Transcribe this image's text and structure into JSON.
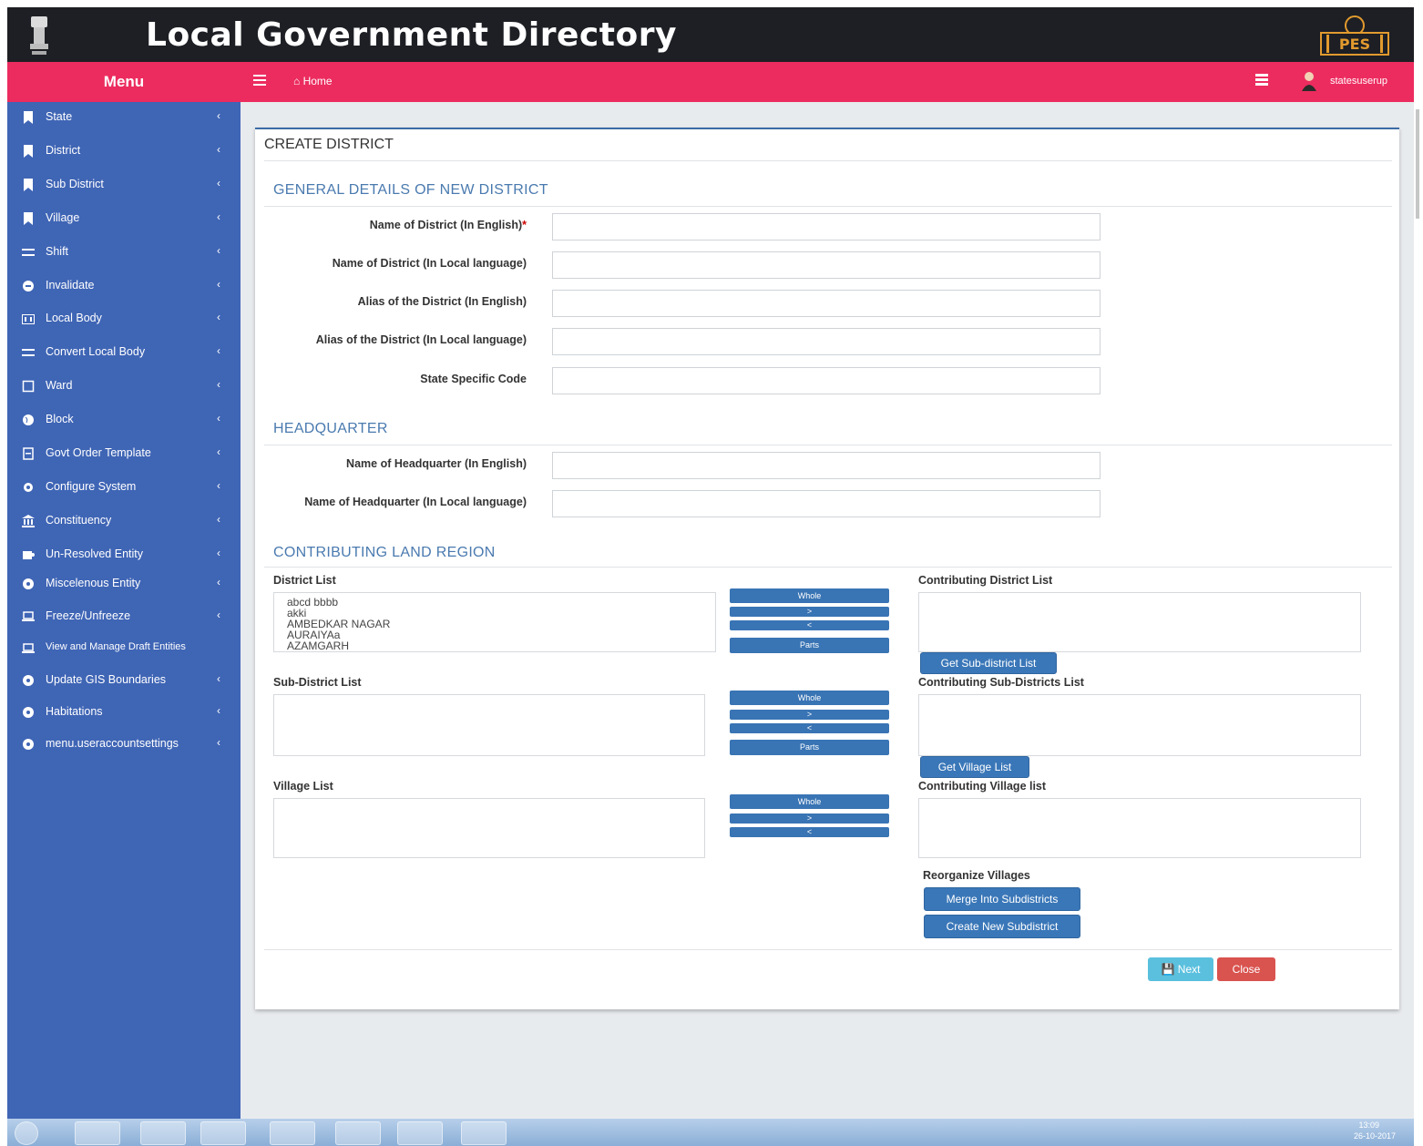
{
  "header": {
    "app_title": "Local Government Directory",
    "logo_text": "PES"
  },
  "menubar": {
    "menu_label": "Menu",
    "home_label": "Home",
    "user_name": "statesuserup"
  },
  "sidebar": {
    "items": [
      {
        "label": "State",
        "icon": "bookmark-icon"
      },
      {
        "label": "District",
        "icon": "bookmark-icon"
      },
      {
        "label": "Sub District",
        "icon": "bookmark-icon"
      },
      {
        "label": "Village",
        "icon": "bookmark-icon"
      },
      {
        "label": "Shift",
        "icon": "exchange-icon"
      },
      {
        "label": "Invalidate",
        "icon": "circle-minus-icon"
      },
      {
        "label": "Local Body",
        "icon": "building-icon"
      },
      {
        "label": "Convert Local Body",
        "icon": "exchange-icon"
      },
      {
        "label": "Ward",
        "icon": "square-icon"
      },
      {
        "label": "Block",
        "icon": "globe-icon"
      },
      {
        "label": "Govt Order Template",
        "icon": "file-icon"
      },
      {
        "label": "Configure System",
        "icon": "gear-icon"
      },
      {
        "label": "Constituency",
        "icon": "bank-icon"
      },
      {
        "label": "Un-Resolved Entity",
        "icon": "puzzle-icon"
      },
      {
        "label": "Miscelenous Entity",
        "icon": "circle-icon"
      },
      {
        "label": "Freeze/Unfreeze",
        "icon": "laptop-icon"
      },
      {
        "label": "View and Manage Draft Entities",
        "icon": "laptop-icon"
      },
      {
        "label": "Update GIS Boundaries",
        "icon": "circle-icon"
      },
      {
        "label": "Habitations",
        "icon": "circle-icon"
      },
      {
        "label": "menu.useraccountsettings",
        "icon": "circle-icon"
      }
    ]
  },
  "form": {
    "title": "CREATE DISTRICT",
    "section_general": "GENERAL DETAILS OF NEW DISTRICT",
    "section_hq": "HEADQUARTER",
    "section_land": "CONTRIBUTING LAND REGION",
    "fields": {
      "name_en": {
        "label": "Name of District (In English)",
        "required": "*",
        "value": ""
      },
      "name_local": {
        "label": "Name of District (In Local language)",
        "value": ""
      },
      "alias_en": {
        "label": "Alias of the District (In English)",
        "value": ""
      },
      "alias_local": {
        "label": "Alias of the District (In Local language)",
        "value": ""
      },
      "state_code": {
        "label": "State Specific Code",
        "value": ""
      },
      "hq_en": {
        "label": "Name of Headquarter (In English)",
        "value": ""
      },
      "hq_local": {
        "label": "Name of Headquarter (In Local language)",
        "value": ""
      }
    },
    "lists": {
      "district_list_label": "District List",
      "district_options": [
        "abcd bbbb",
        "akki",
        "AMBEDKAR NAGAR",
        "AURAIYAa",
        "AZAMGARH"
      ],
      "contrib_district_label": "Contributing District List",
      "subdistrict_list_label": "Sub-District List",
      "contrib_subdistrict_label": "Contributing Sub-Districts List",
      "village_list_label": "Village List",
      "contrib_village_label": "Contributing Village list"
    },
    "transfer_buttons": {
      "whole": "Whole",
      "forward": ">",
      "back": "<",
      "parts": "Parts"
    },
    "get_subdistrict_button": "Get Sub-district List",
    "get_village_button": "Get Village List",
    "reorganize_label": "Reorganize Villages",
    "merge_button": "Merge Into Subdistricts",
    "create_subdistrict_button": "Create New Subdistrict",
    "next_button": "Next",
    "close_button": "Close"
  },
  "taskbar": {
    "time": "13:09",
    "date": "26-10-2017"
  },
  "colors": {
    "topbar": "#1d1f24",
    "menubar": "#ec2c5f",
    "sidebar": "#3f65b5",
    "section_heading": "#4a7aaf",
    "primary_button": "#3a77b8",
    "next_button": "#5bc0de",
    "close_button": "#d9534f"
  }
}
